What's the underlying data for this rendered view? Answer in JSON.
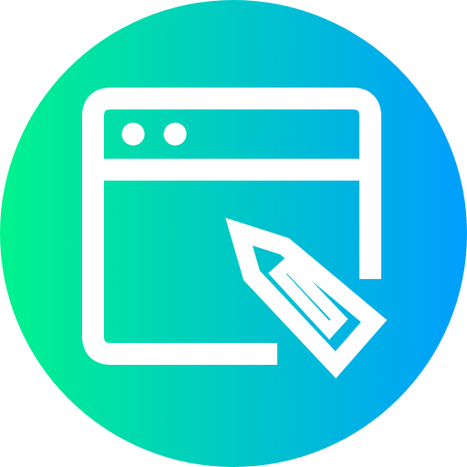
{
  "icon": {
    "name": "browser-window-edit-icon",
    "gradient_start": "#00F38D",
    "gradient_end": "#009EFF",
    "stroke_color": "#FFFFFF",
    "window_dots": 2
  }
}
